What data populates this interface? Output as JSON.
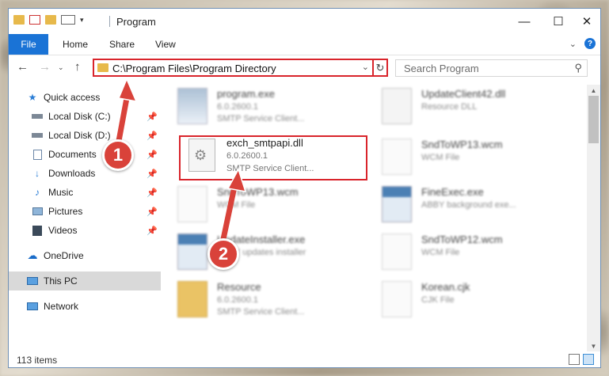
{
  "window": {
    "title": "Program"
  },
  "ribbon": {
    "file": "File",
    "tabs": [
      "Home",
      "Share",
      "View"
    ]
  },
  "address": {
    "path": "C:\\Program Files\\Program Directory",
    "search_placeholder": "Search Program"
  },
  "nav": {
    "items": [
      {
        "label": "Quick access",
        "icon": "star-icon"
      },
      {
        "label": "Local Disk (C:)",
        "icon": "drive-icon",
        "pinned": true
      },
      {
        "label": "Local Disk (D:)",
        "icon": "drive-icon",
        "pinned": true
      },
      {
        "label": "Documents",
        "icon": "documents-icon",
        "pinned": true
      },
      {
        "label": "Downloads",
        "icon": "download-icon",
        "pinned": true
      },
      {
        "label": "Music",
        "icon": "music-icon",
        "pinned": true
      },
      {
        "label": "Pictures",
        "icon": "pictures-icon",
        "pinned": true
      },
      {
        "label": "Videos",
        "icon": "videos-icon",
        "pinned": true
      },
      {
        "label": "OneDrive",
        "icon": "cloud-icon"
      },
      {
        "label": "This PC",
        "icon": "computer-icon",
        "selected": true
      },
      {
        "label": "Network",
        "icon": "network-icon"
      }
    ]
  },
  "files": [
    {
      "name": "program.exe",
      "line2": "6.0.2600.1",
      "line3": "SMTP Service Client..."
    },
    {
      "name": "UpdateClient42.dll",
      "line2": "Resource DLL",
      "line3": ""
    },
    {
      "name": "exch_smtpapi.dll",
      "line2": "6.0.2600.1",
      "line3": "SMTP Service Client..."
    },
    {
      "name": "SndToWP13.wcm",
      "line2": "WCM File",
      "line3": ""
    },
    {
      "name": "SndToWP13.wcm",
      "line2": "WCM File",
      "line3": ""
    },
    {
      "name": "FineExec.exe",
      "line2": "ABBY background exe...",
      "line3": ""
    },
    {
      "name": "UpdateInstaller.exe",
      "line2": "ABBY updates installer",
      "line3": ""
    },
    {
      "name": "SndToWP12.wcm",
      "line2": "WCM File",
      "line3": ""
    },
    {
      "name": "Resource",
      "line2": "6.0.2600.1",
      "line3": "SMTP Service Client..."
    },
    {
      "name": "Korean.cjk",
      "line2": "CJK File",
      "line3": ""
    }
  ],
  "status": {
    "count": "113 items"
  },
  "callouts": [
    "1",
    "2"
  ],
  "colors": {
    "accent": "#1a73d6",
    "highlight": "#d9242b",
    "badge": "#d9423a"
  }
}
